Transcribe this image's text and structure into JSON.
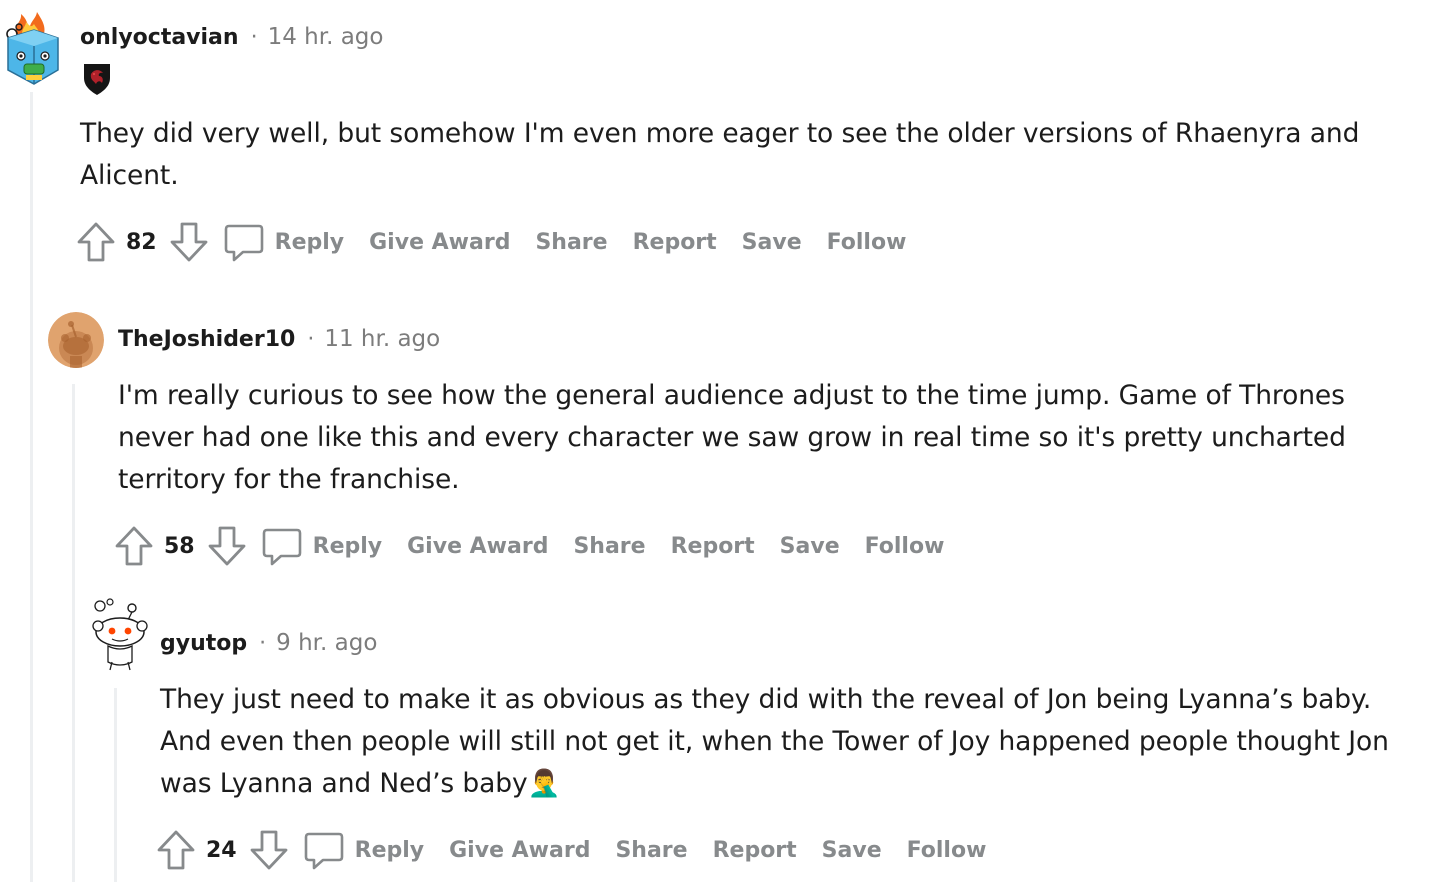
{
  "comments": [
    {
      "username": "onlyoctavian",
      "separator": "·",
      "timestamp": "14 hr. ago",
      "flair_icon": "dragon-crest-flair",
      "avatar_icon": "burning-cube-snoo-avatar",
      "body": "They did very well, but somehow I'm even more eager to see the older versions of Rhaenyra and Alicent.",
      "score": "82",
      "actions": {
        "reply": "Reply",
        "give_award": "Give Award",
        "share": "Share",
        "report": "Report",
        "save": "Save",
        "follow": "Follow"
      }
    },
    {
      "username": "TheJoshider10",
      "separator": "·",
      "timestamp": "11 hr. ago",
      "avatar_icon": "default-snoo-orange-avatar",
      "body": "I'm really curious to see how the general audience adjust to the time jump. Game of Thrones never had one like this and every character we saw grow in real time so it's pretty uncharted territory for the franchise.",
      "score": "58",
      "actions": {
        "reply": "Reply",
        "give_award": "Give Award",
        "share": "Share",
        "report": "Report",
        "save": "Save",
        "follow": "Follow"
      }
    },
    {
      "username": "gyutop",
      "separator": "·",
      "timestamp": "9 hr. ago",
      "avatar_icon": "snoo-outline-avatar",
      "body": "They just need to make it as obvious as they did with the reveal of Jon being Lyanna’s baby. And even then people will still not get it, when the Tower of Joy happened people thought Jon was Lyanna and Ned’s baby🤦‍♂️",
      "score": "24",
      "actions": {
        "reply": "Reply",
        "give_award": "Give Award",
        "share": "Share",
        "report": "Report",
        "save": "Save",
        "follow": "Follow"
      }
    }
  ],
  "icons": {
    "upvote": "upvote-arrow-icon",
    "downvote": "downvote-arrow-icon",
    "reply": "speech-bubble-icon"
  },
  "colors": {
    "text": "#1c1c1c",
    "meta": "#7c7c7c",
    "action": "#878a8c",
    "thread_line": "#edeff1",
    "avatar_orange": "#e0a36e"
  }
}
